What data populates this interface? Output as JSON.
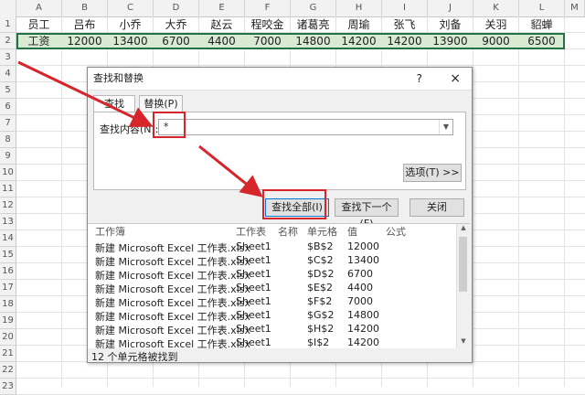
{
  "sheet": {
    "columns": [
      "A",
      "B",
      "C",
      "D",
      "E",
      "F",
      "G",
      "H",
      "I",
      "J",
      "K",
      "L",
      "M"
    ],
    "rows": [
      "1",
      "2",
      "3",
      "4",
      "5",
      "6",
      "7",
      "8",
      "9",
      "10",
      "11",
      "12",
      "13",
      "14",
      "15",
      "16",
      "17",
      "18",
      "19",
      "20",
      "21",
      "22",
      "23"
    ],
    "row1": [
      "员工",
      "吕布",
      "小乔",
      "大乔",
      "赵云",
      "程咬金",
      "诸葛亮",
      "周瑜",
      "张飞",
      "刘备",
      "关羽",
      "貂蝉"
    ],
    "row2": [
      "工资",
      "12000",
      "13400",
      "6700",
      "4400",
      "7000",
      "14800",
      "14200",
      "14200",
      "13900",
      "9000",
      "6500"
    ]
  },
  "dialog": {
    "title": "查找和替换",
    "help": "?",
    "close": "×",
    "tab_find": "查找(D)",
    "tab_replace": "替换(P)",
    "find_label": "查找内容(N):",
    "find_value": "*",
    "options_button": "选项(T) >>",
    "find_all_button": "查找全部(I)",
    "find_next_button": "查找下一个(F)",
    "close_button": "关闭",
    "results_headers": [
      "工作簿",
      "工作表",
      "名称",
      "单元格",
      "值",
      "公式"
    ],
    "results": [
      {
        "wb": "新建 Microsoft Excel 工作表.xlsx",
        "ws": "Sheet1",
        "cell": "$B$2",
        "val": "12000"
      },
      {
        "wb": "新建 Microsoft Excel 工作表.xlsx",
        "ws": "Sheet1",
        "cell": "$C$2",
        "val": "13400"
      },
      {
        "wb": "新建 Microsoft Excel 工作表.xlsx",
        "ws": "Sheet1",
        "cell": "$D$2",
        "val": "6700"
      },
      {
        "wb": "新建 Microsoft Excel 工作表.xlsx",
        "ws": "Sheet1",
        "cell": "$E$2",
        "val": "4400"
      },
      {
        "wb": "新建 Microsoft Excel 工作表.xlsx",
        "ws": "Sheet1",
        "cell": "$F$2",
        "val": "7000"
      },
      {
        "wb": "新建 Microsoft Excel 工作表.xlsx",
        "ws": "Sheet1",
        "cell": "$G$2",
        "val": "14800"
      },
      {
        "wb": "新建 Microsoft Excel 工作表.xlsx",
        "ws": "Sheet1",
        "cell": "$H$2",
        "val": "14200"
      },
      {
        "wb": "新建 Microsoft Excel 工作表.xlsx",
        "ws": "Sheet1",
        "cell": "$I$2",
        "val": "14200"
      }
    ],
    "status": "12 个单元格被找到"
  },
  "colors": {
    "annotation_red": "#d6262c",
    "selection_green": "#217346"
  }
}
